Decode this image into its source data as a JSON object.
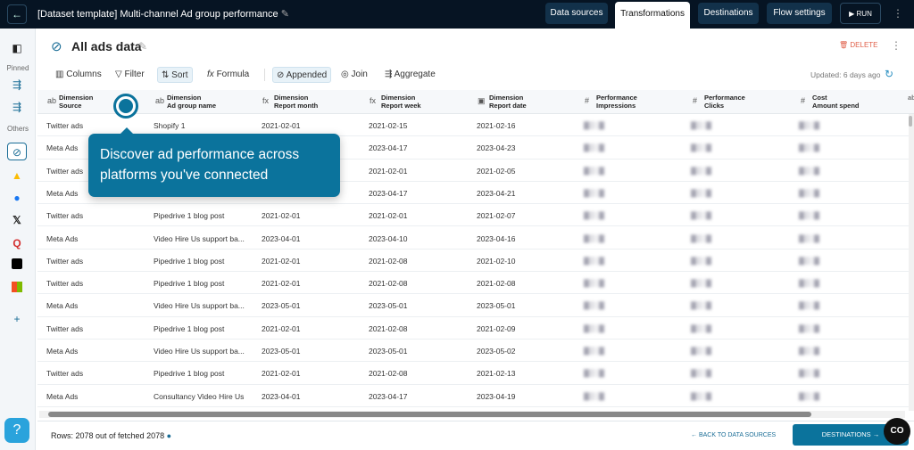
{
  "topbar": {
    "title": "[Dataset template] Multi-channel Ad group performance",
    "tabs": [
      "Data sources",
      "Transformations",
      "Destinations",
      "Flow settings"
    ],
    "run": "RUN"
  },
  "sidebar": {
    "pinned": "Pinned",
    "others": "Others",
    "help": "?"
  },
  "header": {
    "title": "All ads data",
    "delete": "DELETE",
    "updated": "Updated: 6 days ago"
  },
  "toolbar": {
    "columns": "Columns",
    "filter": "Filter",
    "sort": "Sort",
    "formula": "Formula",
    "appended": "Appended",
    "join": "Join",
    "aggregate": "Aggregate"
  },
  "columns": [
    {
      "type": "ab",
      "group": "Dimension",
      "name": "Source"
    },
    {
      "type": "ab",
      "group": "Dimension",
      "name": "Ad group name"
    },
    {
      "type": "fx",
      "group": "Dimension",
      "name": "Report month"
    },
    {
      "type": "fx",
      "group": "Dimension",
      "name": "Report week"
    },
    {
      "type": "cal",
      "group": "Dimension",
      "name": "Report date"
    },
    {
      "type": "#",
      "group": "Performance",
      "name": "Impressions"
    },
    {
      "type": "#",
      "group": "Performance",
      "name": "Clicks"
    },
    {
      "type": "#",
      "group": "Cost",
      "name": "Amount spend"
    }
  ],
  "rows": [
    [
      "Twitter ads",
      "Shopify 1",
      "2021-02-01",
      "2021-02-15",
      "2021-02-16"
    ],
    [
      "Meta Ads",
      "",
      "",
      "2023-04-17",
      "2023-04-23"
    ],
    [
      "Twitter ads",
      "",
      "",
      "2021-02-01",
      "2021-02-05"
    ],
    [
      "Meta Ads",
      "",
      "",
      "2023-04-17",
      "2023-04-21"
    ],
    [
      "Twitter ads",
      "Pipedrive 1 blog post",
      "2021-02-01",
      "2021-02-01",
      "2021-02-07"
    ],
    [
      "Meta Ads",
      "Video Hire Us support ba...",
      "2023-04-01",
      "2023-04-10",
      "2023-04-16"
    ],
    [
      "Twitter ads",
      "Pipedrive 1 blog post",
      "2021-02-01",
      "2021-02-08",
      "2021-02-10"
    ],
    [
      "Twitter ads",
      "Pipedrive 1 blog post",
      "2021-02-01",
      "2021-02-08",
      "2021-02-08"
    ],
    [
      "Meta Ads",
      "Video Hire Us support ba...",
      "2023-05-01",
      "2023-05-01",
      "2023-05-01"
    ],
    [
      "Twitter ads",
      "Pipedrive 1 blog post",
      "2021-02-01",
      "2021-02-08",
      "2021-02-09"
    ],
    [
      "Meta Ads",
      "Video Hire Us support ba...",
      "2023-05-01",
      "2023-05-01",
      "2023-05-02"
    ],
    [
      "Twitter ads",
      "Pipedrive 1 blog post",
      "2021-02-01",
      "2021-02-08",
      "2021-02-13"
    ],
    [
      "Meta Ads",
      "Consultancy Video Hire Us",
      "2023-04-01",
      "2023-04-17",
      "2023-04-19"
    ]
  ],
  "tooltip": "Discover ad performance across platforms you've connected",
  "footer": {
    "rows": "Rows: 2078 out of fetched 2078",
    "back": "← BACK TO DATA SOURCES",
    "next": "DESTINATIONS →",
    "chat": "CO"
  }
}
